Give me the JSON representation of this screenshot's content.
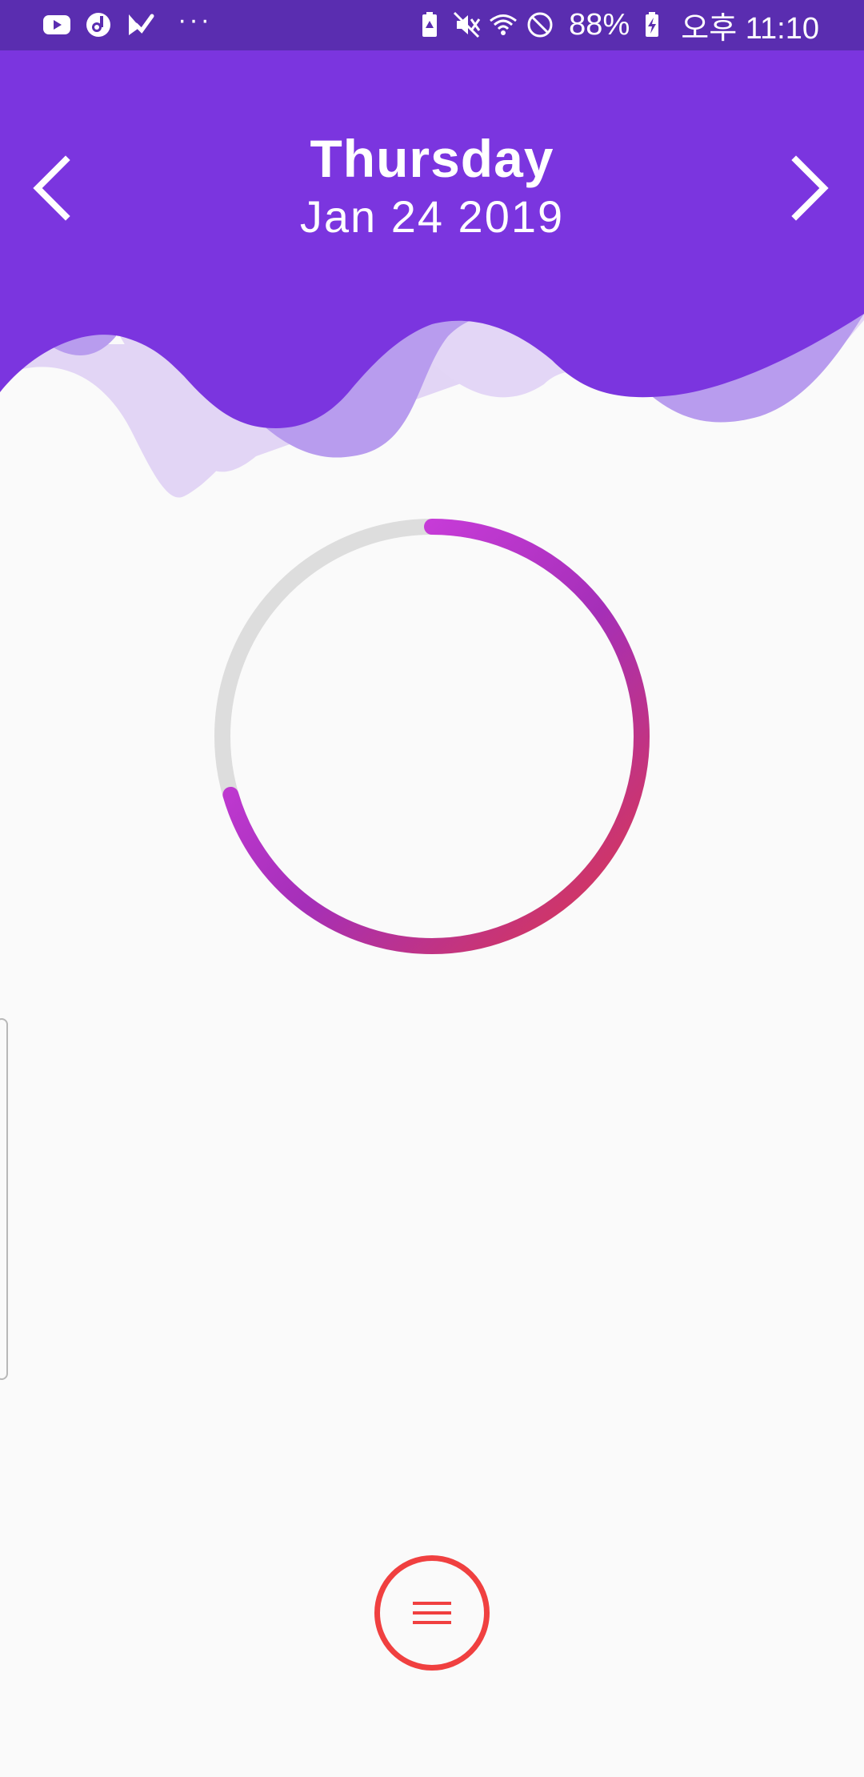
{
  "status_bar": {
    "left_icons": [
      "youtube-icon",
      "music-app-icon",
      "task-check-icon"
    ],
    "more_indicator": "···",
    "right_icons": [
      "battery-saver-icon",
      "mute-icon",
      "wifi-icon",
      "do-not-disturb-icon"
    ],
    "battery_percent": "88%",
    "time": "오후 11:10",
    "background_color": "#5a2db0"
  },
  "header": {
    "day": "Thursday",
    "date": "Jan 24 2019",
    "background_color": "#7b35df",
    "prev_icon": "chevron-left-icon",
    "next_icon": "chevron-right-icon"
  },
  "progress": {
    "fraction": 0.705,
    "track_color": "#dddddd",
    "gradient_start_color": "#e03848",
    "gradient_mid_color": "#a52fb8",
    "gradient_end_color": "#e045f0"
  },
  "drawer": {
    "icon": "drawer-handle"
  },
  "fab": {
    "icon": "menu-icon",
    "color": "#f04040"
  }
}
